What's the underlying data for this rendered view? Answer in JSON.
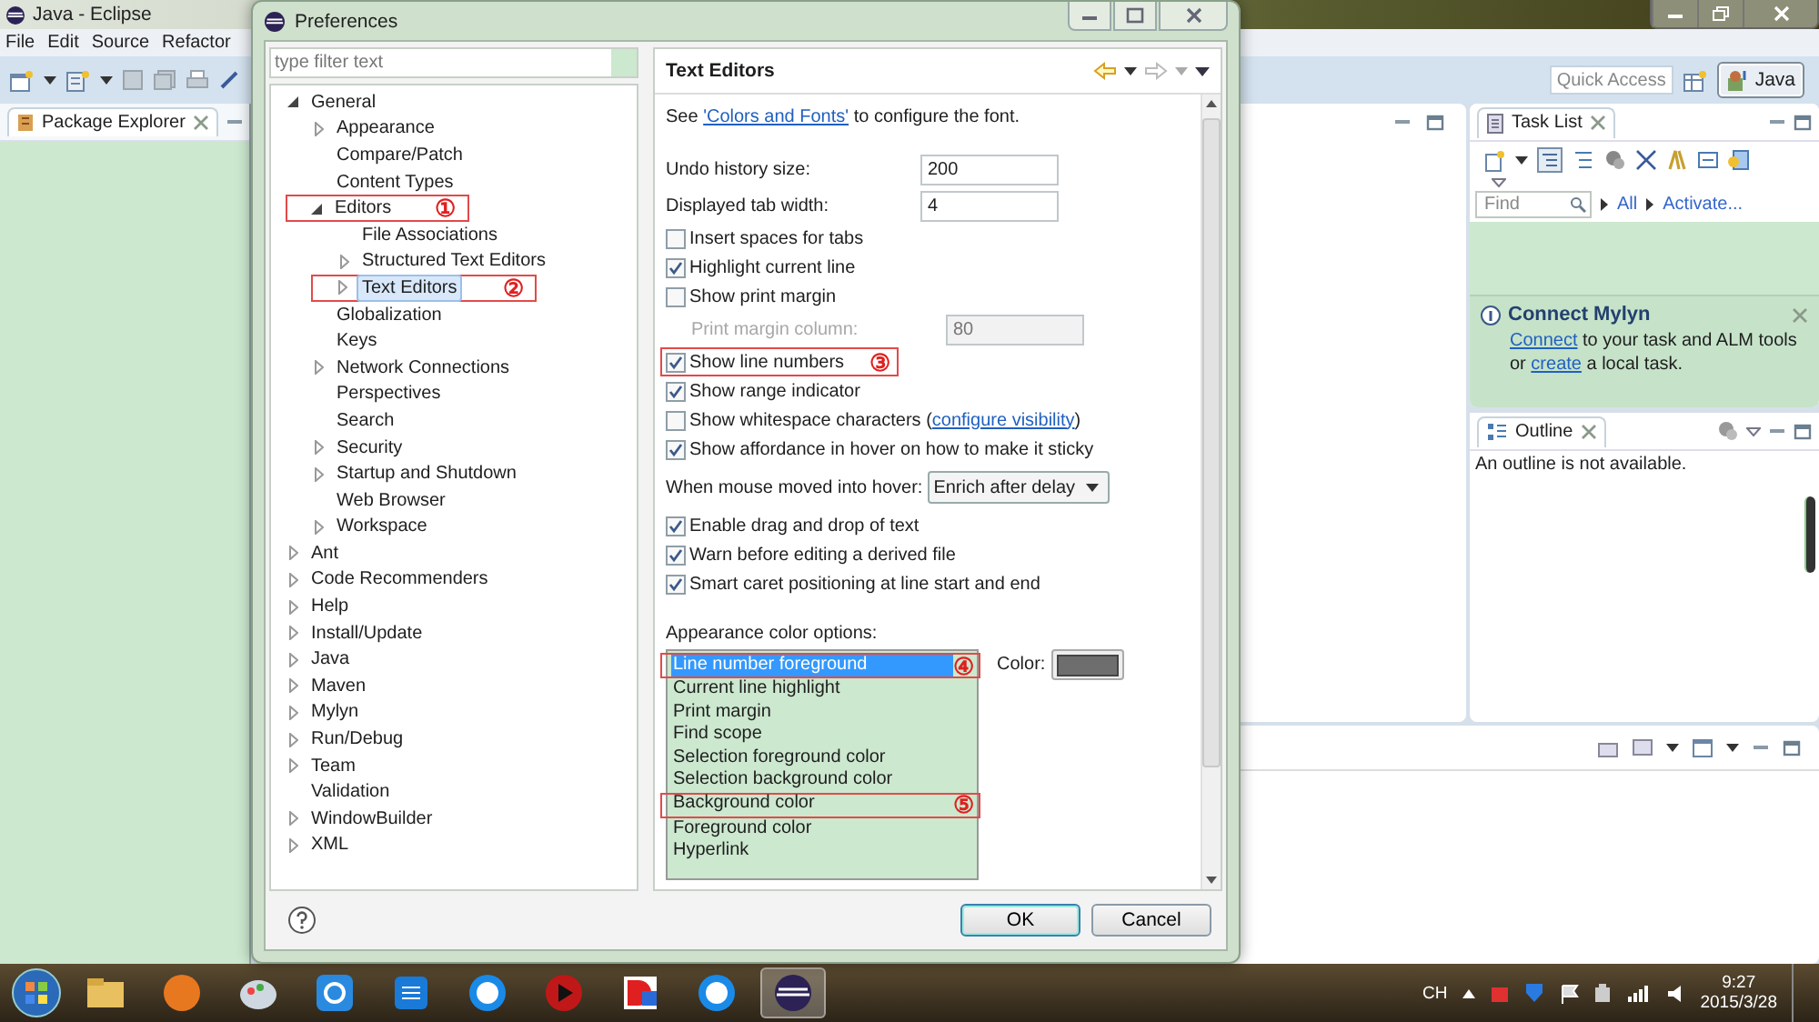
{
  "eclipse": {
    "title": "Java - Eclipse",
    "menu": [
      "File",
      "Edit",
      "Source",
      "Refactor"
    ],
    "quick_access": {
      "placeholder": "Quick Access"
    },
    "perspective": {
      "label": "Java",
      "selected": true
    },
    "package_explorer": {
      "title": "Package Explorer"
    },
    "task_list": {
      "title": "Task List",
      "find": {
        "placeholder": "Find"
      },
      "filters": [
        "All",
        "Activate..."
      ],
      "notice": {
        "title": "Connect Mylyn",
        "text": [
          {
            "text": "Connect",
            "link": true
          },
          {
            "text": " to your task and ALM tools or ",
            "link": false
          },
          {
            "text": "create",
            "link": true
          },
          {
            "text": " a local task.",
            "link": false
          }
        ]
      }
    },
    "outline": {
      "title": "Outline",
      "message": "An outline is not available."
    }
  },
  "dialog": {
    "title": "Preferences",
    "filter": {
      "placeholder": "type filter text"
    },
    "tree": [
      {
        "label": "General",
        "expanded": true,
        "selected": false,
        "children": [
          {
            "label": "Appearance",
            "expanded": false,
            "selected": false
          },
          {
            "label": "Compare/Patch",
            "selected": false
          },
          {
            "label": "Content Types",
            "selected": false
          },
          {
            "label": "Editors",
            "expanded": true,
            "selected": false,
            "annotation": "①",
            "children": [
              {
                "label": "File Associations",
                "selected": false
              },
              {
                "label": "Structured Text Editors",
                "expanded": false,
                "selected": false
              },
              {
                "label": "Text Editors",
                "expanded": false,
                "selected": true,
                "annotation": "②"
              }
            ]
          },
          {
            "label": "Globalization",
            "selected": false
          },
          {
            "label": "Keys",
            "selected": false
          },
          {
            "label": "Network Connections",
            "expanded": false,
            "selected": false
          },
          {
            "label": "Perspectives",
            "selected": false
          },
          {
            "label": "Search",
            "selected": false
          },
          {
            "label": "Security",
            "expanded": false,
            "selected": false
          },
          {
            "label": "Startup and Shutdown",
            "expanded": false,
            "selected": false
          },
          {
            "label": "Web Browser",
            "selected": false
          },
          {
            "label": "Workspace",
            "expanded": false,
            "selected": false
          }
        ]
      },
      {
        "label": "Ant",
        "expanded": false,
        "selected": false
      },
      {
        "label": "Code Recommenders",
        "expanded": false,
        "selected": false
      },
      {
        "label": "Help",
        "expanded": false,
        "selected": false
      },
      {
        "label": "Install/Update",
        "expanded": false,
        "selected": false
      },
      {
        "label": "Java",
        "expanded": false,
        "selected": false
      },
      {
        "label": "Maven",
        "expanded": false,
        "selected": false
      },
      {
        "label": "Mylyn",
        "expanded": false,
        "selected": false
      },
      {
        "label": "Run/Debug",
        "expanded": false,
        "selected": false
      },
      {
        "label": "Team",
        "expanded": false,
        "selected": false
      },
      {
        "label": "Validation",
        "selected": false
      },
      {
        "label": "WindowBuilder",
        "expanded": false,
        "selected": false
      },
      {
        "label": "XML",
        "expanded": false,
        "selected": false
      }
    ],
    "page": {
      "title": "Text Editors",
      "intro": [
        {
          "text": "See ",
          "link": false
        },
        {
          "text": "'Colors and Fonts'",
          "link": true
        },
        {
          "text": " to configure the font.",
          "link": false
        }
      ],
      "rows": [
        {
          "kind": "field",
          "label": "Undo history size:",
          "value": "200",
          "disabled": false
        },
        {
          "kind": "field",
          "label": "Displayed tab width:",
          "value": "4",
          "disabled": false
        },
        {
          "kind": "checkbox",
          "label": "Insert spaces for tabs",
          "checked": false
        },
        {
          "kind": "checkbox",
          "label": "Highlight current line",
          "checked": true
        },
        {
          "kind": "checkbox",
          "label": "Show print margin",
          "checked": false,
          "children": [
            {
              "kind": "field",
              "label": "Print margin column:",
              "value": "80",
              "disabled": true
            }
          ]
        },
        {
          "kind": "checkbox",
          "label": "Show line numbers",
          "checked": true,
          "annotation": "③"
        },
        {
          "kind": "checkbox",
          "label": "Show range indicator",
          "checked": true
        },
        {
          "kind": "checkbox",
          "label": [
            {
              "text": "Show whitespace characters (",
              "link": false
            },
            {
              "text": "configure visibility",
              "link": true
            },
            {
              "text": ")",
              "link": false
            }
          ],
          "checked": false
        },
        {
          "kind": "checkbox",
          "label": "Show affordance in hover on how to make it sticky",
          "checked": true
        },
        {
          "kind": "dropdown",
          "label": "When mouse moved into hover:",
          "value": "Enrich after delay"
        },
        {
          "kind": "checkbox",
          "label": "Enable drag and drop of text",
          "checked": true
        },
        {
          "kind": "checkbox",
          "label": "Warn before editing a derived file",
          "checked": true
        },
        {
          "kind": "checkbox",
          "label": "Smart caret positioning at line start and end",
          "checked": true
        }
      ],
      "colors": {
        "label": "Appearance color options:",
        "color_label": "Color:",
        "color": "#6e6e6e",
        "items": [
          {
            "label": "Line number foreground",
            "selected": true,
            "annotation": "④"
          },
          {
            "label": "Current line highlight",
            "selected": false
          },
          {
            "label": "Print margin",
            "selected": false
          },
          {
            "label": "Find scope",
            "selected": false
          },
          {
            "label": "Selection foreground color",
            "selected": false
          },
          {
            "label": "Selection background color",
            "selected": false
          },
          {
            "label": "Background color",
            "selected": false,
            "annotation": "⑤"
          },
          {
            "label": "Foreground color",
            "selected": false
          },
          {
            "label": "Hyperlink",
            "selected": false
          }
        ]
      }
    },
    "buttons": [
      {
        "label": "OK",
        "default": true
      },
      {
        "label": "Cancel",
        "default": false
      }
    ]
  },
  "taskbar": {
    "language": "CH",
    "time": "9:27",
    "date": "2015/3/28"
  }
}
